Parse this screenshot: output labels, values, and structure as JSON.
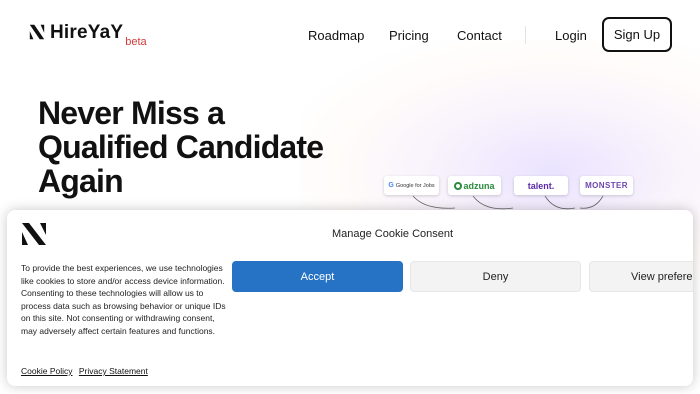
{
  "header": {
    "brand": "HireYaY",
    "beta": "beta",
    "nav": [
      "Roadmap",
      "Pricing",
      "Contact"
    ],
    "login": "Login",
    "signup": "Sign Up"
  },
  "hero": {
    "title_lines": [
      "Never Miss a",
      "Qualified Candidate",
      "Again"
    ]
  },
  "job_boards": {
    "google": "Google for Jobs",
    "adzuna": "adzuna",
    "talent": "talent.",
    "monster": "MONSTER"
  },
  "cookie": {
    "title": "Manage Cookie Consent",
    "body": "To provide the best experiences, we use technologies like cookies to store and/or access device information. Consenting to these technologies will allow us to process data such as browsing behavior or unique IDs on this site. Not consenting or withdrawing consent, may adversely affect certain features and functions.",
    "accept": "Accept",
    "deny": "Deny",
    "view_preferences": "View preferences",
    "links": [
      "Cookie Policy",
      "Privacy Statement"
    ]
  },
  "colors": {
    "accent_blue": "#2673c6",
    "beta_red": "#d23c3c",
    "adzuna_green": "#2b8a3e",
    "monster_purple": "#6e46ae"
  }
}
